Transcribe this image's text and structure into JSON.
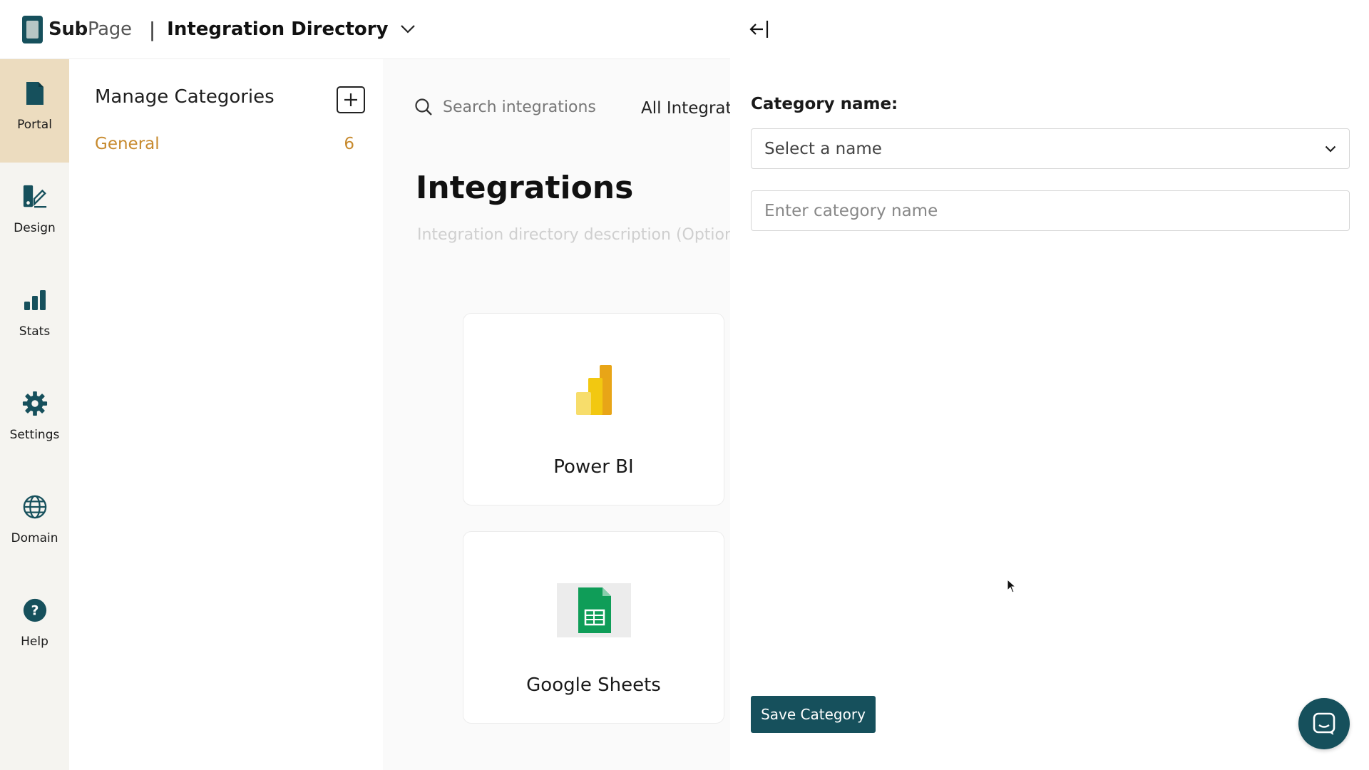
{
  "brand": {
    "name_bold": "Sub",
    "name_light": "Page",
    "separator": "|"
  },
  "header": {
    "directory_title": "Integration Directory"
  },
  "rail": {
    "items": [
      {
        "label": "Portal",
        "icon": "document-icon",
        "active": true
      },
      {
        "label": "Design",
        "icon": "design-icon",
        "active": false
      },
      {
        "label": "Stats",
        "icon": "bar-chart-icon",
        "active": false
      },
      {
        "label": "Settings",
        "icon": "gear-icon",
        "active": false
      },
      {
        "label": "Domain",
        "icon": "globe-icon",
        "active": false
      },
      {
        "label": "Help",
        "icon": "help-icon",
        "active": false
      }
    ]
  },
  "categories": {
    "title": "Manage Categories",
    "items": [
      {
        "name": "General",
        "count": "6"
      }
    ]
  },
  "main": {
    "search_placeholder": "Search integrations",
    "tab_label": "All Integrati",
    "title": "Integrations",
    "description_placeholder": "Integration directory description (Optiona",
    "cards": [
      {
        "name": "Power BI",
        "icon": "power-bi-icon"
      },
      {
        "name": "Google Sheets",
        "icon": "google-sheets-icon"
      }
    ]
  },
  "drawer": {
    "field_label": "Category name:",
    "select_placeholder": "Select a name",
    "input_placeholder": "Enter category name",
    "save_label": "Save Category"
  },
  "colors": {
    "primary": "#16505c",
    "accent": "#c78a2e",
    "active_rail": "#ecdcbf"
  }
}
